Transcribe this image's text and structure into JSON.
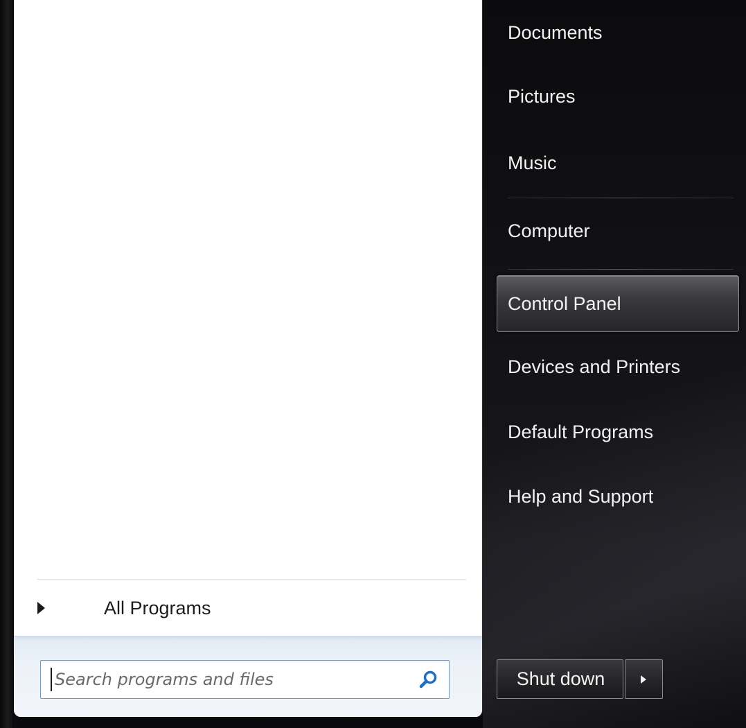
{
  "start_menu": {
    "left_pane": {
      "all_programs_label": "All Programs",
      "search": {
        "placeholder": "Search programs and files",
        "value": ""
      }
    },
    "right_pane": {
      "items": [
        {
          "label": "Documents"
        },
        {
          "label": "Pictures"
        },
        {
          "label": "Music"
        },
        {
          "label": "Computer"
        },
        {
          "label": "Control Panel",
          "selected": true
        },
        {
          "label": "Devices and Printers"
        },
        {
          "label": "Default Programs"
        },
        {
          "label": "Help and Support"
        }
      ],
      "shutdown_label": "Shut down"
    }
  },
  "colors": {
    "right_pane_background": "#121216",
    "left_pane_background": "#ffffff",
    "search_border": "#7d96b2",
    "search_icon": "#1e6fc4"
  },
  "icons": {
    "search": "search-icon",
    "all_programs_arrow": "triangle-right-icon",
    "shutdown_options": "triangle-right-icon"
  }
}
